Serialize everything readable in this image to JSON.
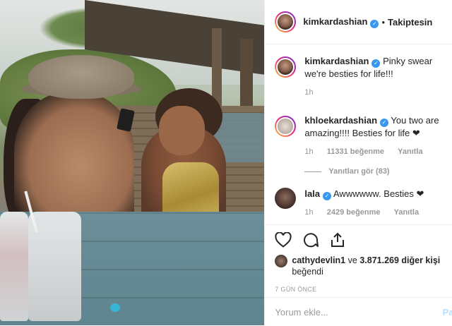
{
  "header": {
    "username": "kimkardashian",
    "separator": "•",
    "follow_status": "Takiptesin"
  },
  "comments": [
    {
      "username": "kimkardashian",
      "text": "Pinky swear we're besties for life!!!",
      "time": "1h"
    },
    {
      "username": "khloekardashian",
      "text": "You two are amazing!!!! Besties for life ❤",
      "time": "1h",
      "likes": "11331 beğenme",
      "reply_label": "Yanıtla",
      "view_replies": "Yanıtları gör (83)"
    },
    {
      "username": "lala",
      "text": "Awwwwww. Besties ❤",
      "time": "1h",
      "likes": "2429 beğenme",
      "reply_label": "Yanıtla"
    }
  ],
  "actions": {
    "icons": [
      "heart-icon",
      "comment-icon",
      "share-icon"
    ]
  },
  "liked_by": {
    "user": "cathydevlin1",
    "connector": "ve",
    "others": "3.871.269 diğer kişi",
    "suffix": "beğendi"
  },
  "date": "7 GÜN ÖNCE",
  "add_comment": {
    "placeholder": "Yorum ekle...",
    "post_label": "Pa"
  }
}
